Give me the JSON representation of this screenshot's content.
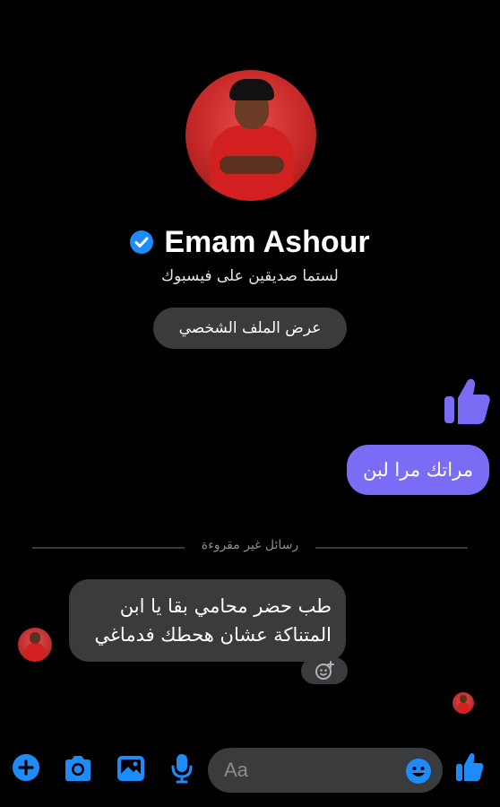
{
  "profile": {
    "name": "Emam Ashour",
    "verified": true,
    "relationship_text": "لستما صديقين على فيسبوك",
    "view_profile_label": "عرض الملف الشخصي"
  },
  "messages": {
    "sent": [
      {
        "type": "like-sticker"
      },
      {
        "type": "text",
        "text": "مراتك مرا لبن"
      }
    ],
    "unread_divider": "رسائل غير مقروءة",
    "received": {
      "line1": "طب حضر محامي بقا يا ابن",
      "line2": "المتناكة عشان هحطك فدماغي"
    }
  },
  "composer": {
    "placeholder": "Aa",
    "icons": [
      "plus-icon",
      "camera-icon",
      "image-icon",
      "microphone-icon",
      "emoji-icon",
      "like-icon"
    ]
  },
  "colors": {
    "background": "#000000",
    "accent": "#1d8cf8",
    "sent_bubble": "#7b6cf6",
    "received_bubble": "#3a3b3c"
  }
}
